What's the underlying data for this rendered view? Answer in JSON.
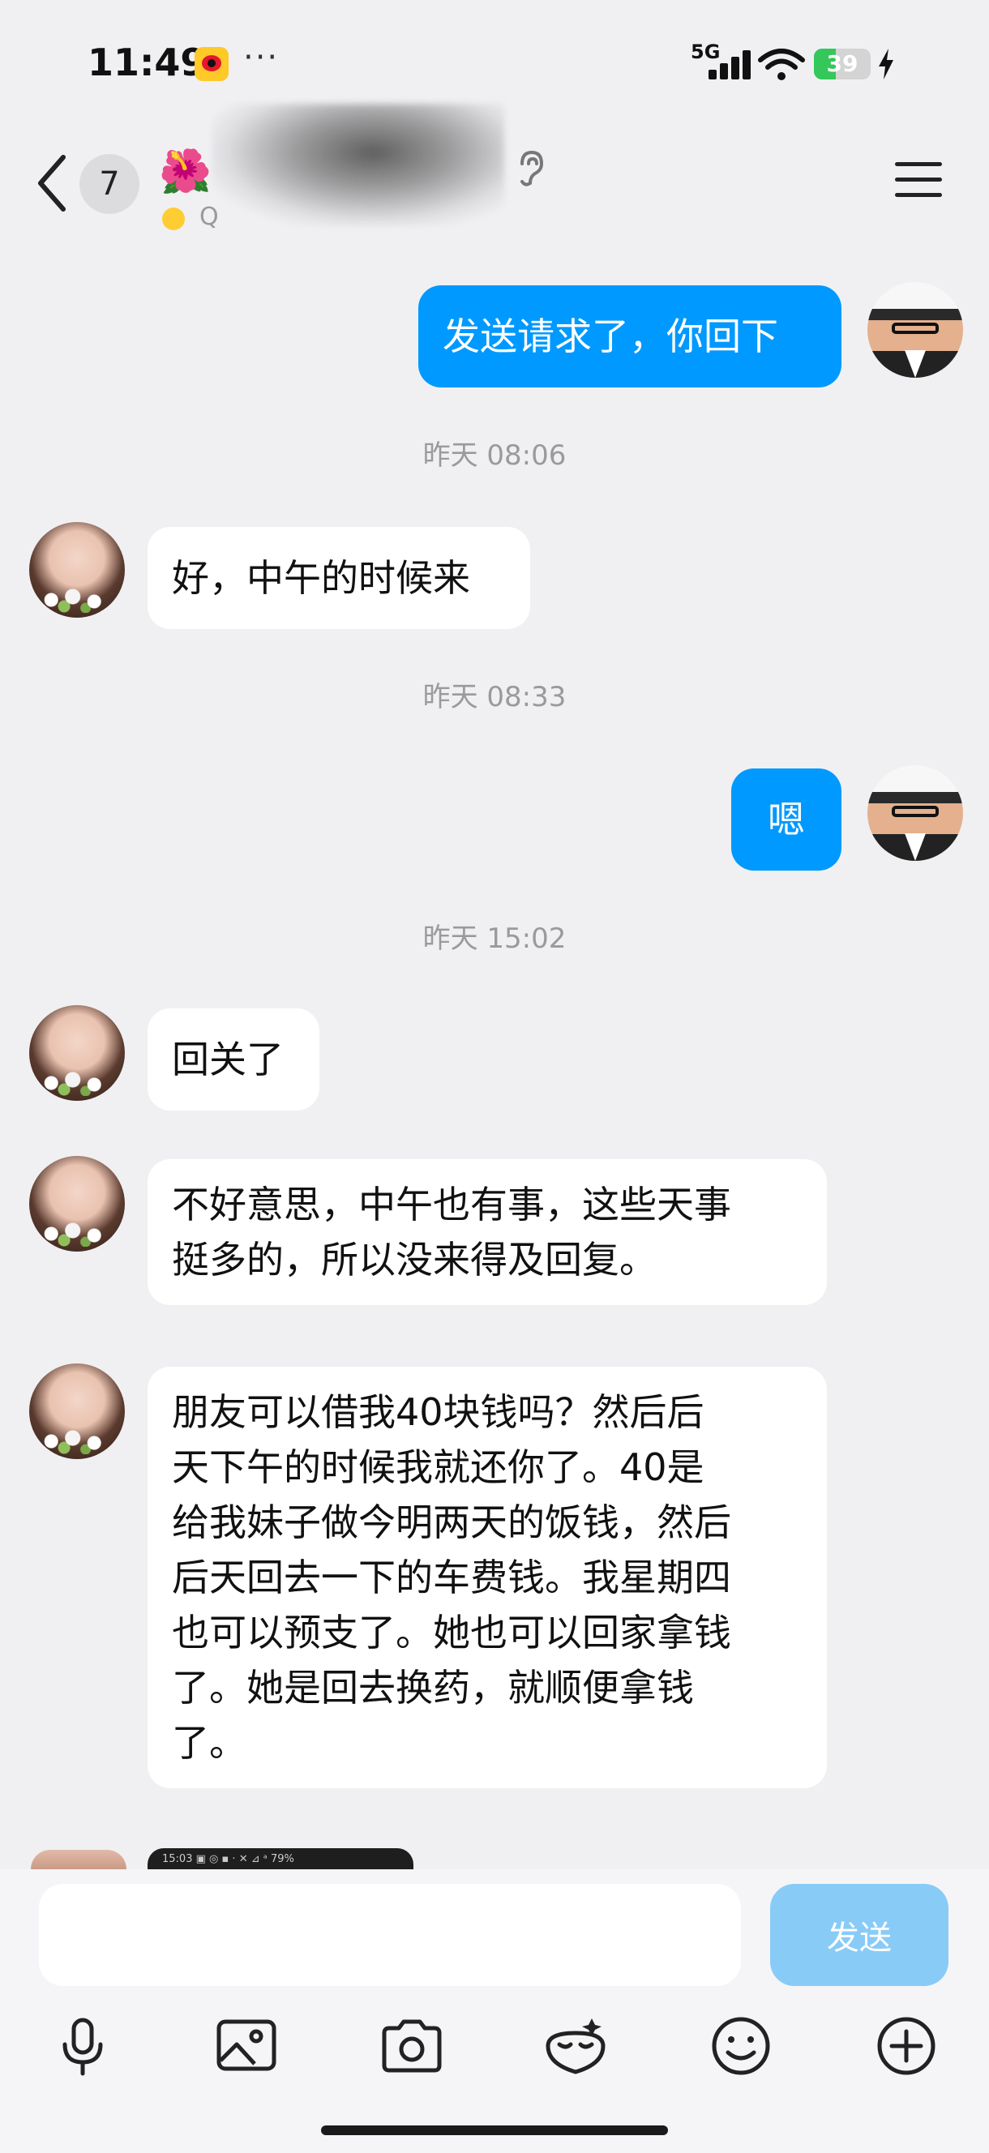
{
  "status_bar": {
    "time": "11:49",
    "dots": "···",
    "network": "5G",
    "battery": "39",
    "battery_level": 0.39
  },
  "header": {
    "unread_count": "7",
    "flower_emoji": "🌺",
    "subtitle_prefix": "Q",
    "send_label_colors": {
      "accent": "#0099ff"
    }
  },
  "messages": [
    {
      "side": "out",
      "text": "发送请求了，你回下"
    },
    {
      "type": "time",
      "text": "昨天 08:06"
    },
    {
      "side": "in",
      "text": "好，中午的时候来"
    },
    {
      "type": "time",
      "text": "昨天 08:33"
    },
    {
      "side": "out",
      "text": "嗯"
    },
    {
      "type": "time",
      "text": "昨天 15:02"
    },
    {
      "side": "in",
      "text": "回关了"
    },
    {
      "side": "in",
      "lines": [
        "不好意思，中午也有事，这些天事",
        "挺多的，所以没来得及回复。"
      ]
    },
    {
      "side": "in",
      "lines": [
        "朋友可以借我40块钱吗？然后后",
        "天下午的时候我就还你了。40是",
        "给我妹子做今明两天的饭钱，然后",
        "后天回去一下的车费钱。我星期四",
        "也可以预支了。她也可以回家拿钱",
        "了。她是回去换药，就顺便拿钱",
        "了。"
      ]
    }
  ],
  "preview_card": {
    "text": "15:03 ▣ ◎ ▪ ·        ✕ ⊿ ᵃ 79%"
  },
  "composer": {
    "placeholder": "",
    "send_label": "发送"
  },
  "toolbar_icons": [
    "microphone-icon",
    "image-icon",
    "camera-icon",
    "sticker-icon",
    "emoji-icon",
    "plus-icon"
  ]
}
